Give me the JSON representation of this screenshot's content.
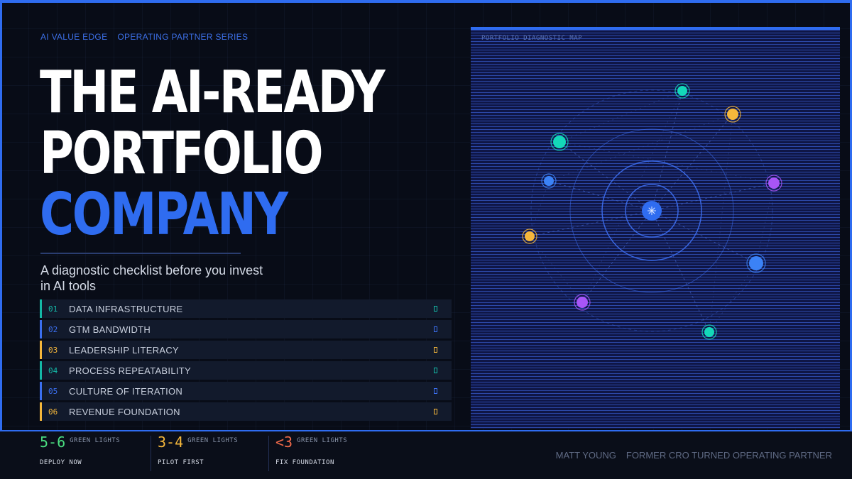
{
  "kicker": {
    "brand": "AI VALUE EDGE",
    "series": "OPERATING PARTNER SERIES"
  },
  "title": {
    "line1": "THE AI-READY",
    "line2": "PORTFOLIO",
    "line3": "COMPANY"
  },
  "subtitle": "A diagnostic checklist before you invest in AI tools",
  "checklist": [
    {
      "num": "01",
      "label": "DATA INFRASTRUCTURE",
      "color": "#14b8a6"
    },
    {
      "num": "02",
      "label": "GTM BANDWIDTH",
      "color": "#3b6ff0"
    },
    {
      "num": "03",
      "label": "LEADERSHIP LITERACY",
      "color": "#f5b73b"
    },
    {
      "num": "04",
      "label": "PROCESS REPEATABILITY",
      "color": "#14b8a6"
    },
    {
      "num": "05",
      "label": "CULTURE OF ITERATION",
      "color": "#3b6ff0"
    },
    {
      "num": "06",
      "label": "REVENUE FOUNDATION",
      "color": "#f5b73b"
    }
  ],
  "map": {
    "label": "PORTFOLIO DIAGNOSTIC MAP",
    "colors": {
      "teal": "#14d8b8",
      "gold": "#f5b73b",
      "purple": "#a855f7",
      "blue": "#3b82f6"
    }
  },
  "tiers": [
    {
      "value": "5-6",
      "unit": "GREEN LIGHTS",
      "action": "DEPLOY NOW",
      "color": "#4ade80"
    },
    {
      "value": "3-4",
      "unit": "GREEN LIGHTS",
      "action": "PILOT FIRST",
      "color": "#f5b73b"
    },
    {
      "value": "<3",
      "unit": "GREEN LIGHTS",
      "action": "FIX FOUNDATION",
      "color": "#f06a4a"
    }
  ],
  "credit": {
    "name": "MATT YOUNG",
    "role": "FORMER CRO TURNED OPERATING PARTNER"
  },
  "colors": {
    "accent": "#2f6cf0",
    "background": "#080c17"
  }
}
